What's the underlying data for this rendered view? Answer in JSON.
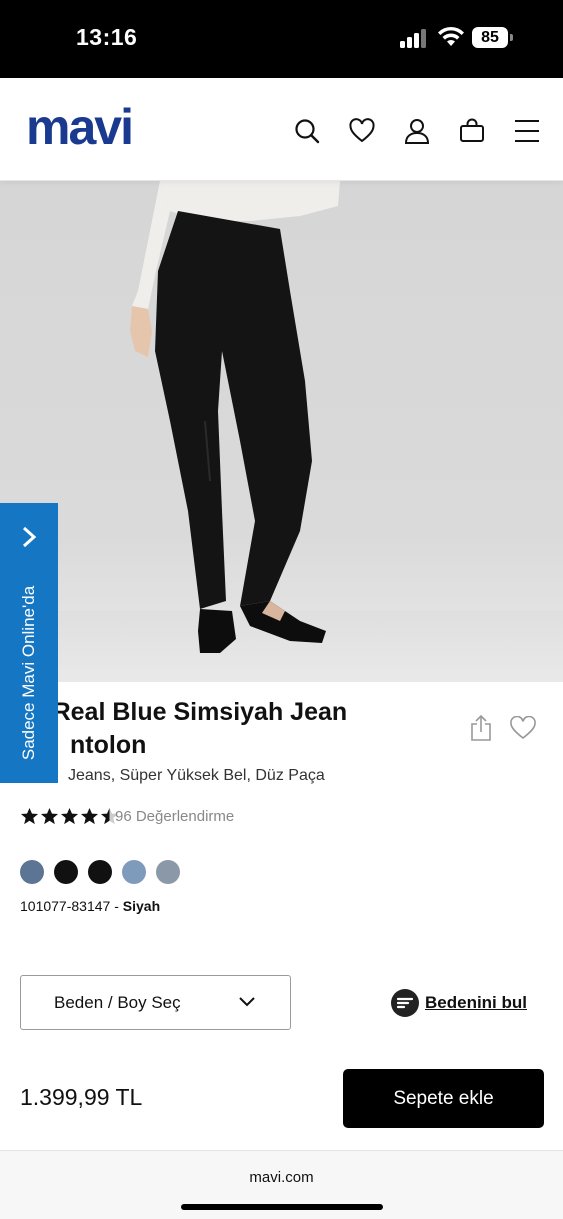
{
  "status": {
    "time": "13:16",
    "battery": "85"
  },
  "header": {
    "logo": "mavi",
    "logo_color": "#1a3a8f",
    "icons": [
      "search-icon",
      "heart-icon",
      "user-icon",
      "bag-icon",
      "menu-icon"
    ]
  },
  "side_banner": {
    "text": "Sadece Mavi Online'da",
    "color": "#1577c4"
  },
  "product": {
    "title": "ar Real Blue Simsiyah Jean ntolon",
    "title_line1": "ar Real Blue Simsiyah Jean",
    "title_line2": "ntolon",
    "subtitle": "Jeans, Süper Yüksek Bel, Düz Paça",
    "rating_text": "96 Değerlendirme",
    "rating_value": 4.5,
    "swatch_colors": [
      "#5c7595",
      "#111111",
      "#111111",
      "#7f9bbb",
      "#8a98a8"
    ],
    "sku": "101077-83147 - ",
    "color_name": "Siyah",
    "size_select": "Beden / Boy Seç",
    "fit_link": "Bedenini bul",
    "price": "1.399,99 TL",
    "add_to_cart": "Sepete ekle"
  },
  "browser": {
    "url": "mavi.com"
  }
}
